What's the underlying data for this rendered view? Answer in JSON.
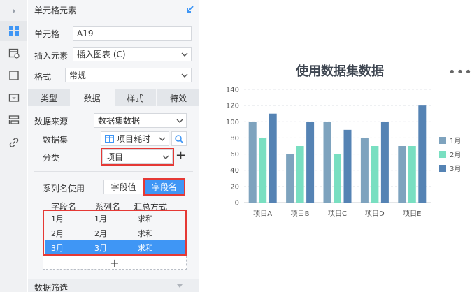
{
  "panel": {
    "title": "单元格元素",
    "cell_label": "单元格",
    "cell_value": "A19",
    "insert_label": "插入元素",
    "insert_value": "插入图表 (C)",
    "format_label": "格式",
    "format_value": "常规",
    "tabs": [
      "类型",
      "数据",
      "样式",
      "特效"
    ],
    "source_label": "数据来源",
    "source_value": "数据集数据",
    "dataset_label": "数据集",
    "dataset_value": "项目耗时",
    "category_label": "分类",
    "category_value": "项目",
    "series_name_label": "系列名使用",
    "seg_field_value": "字段值",
    "seg_field_name": "字段名",
    "table_headers": [
      "字段名",
      "系列名",
      "汇总方式"
    ],
    "rows": [
      {
        "field": "1月",
        "series": "1月",
        "agg": "求和"
      },
      {
        "field": "2月",
        "series": "2月",
        "agg": "求和"
      },
      {
        "field": "3月",
        "series": "3月",
        "agg": "求和"
      }
    ],
    "add_symbol": "+",
    "plus_symbol": "+",
    "filter_label": "数据筛选"
  },
  "chart": {
    "more_symbol": "•••"
  },
  "chart_data": {
    "type": "bar",
    "title": "使用数据集数据",
    "categories": [
      "项目A",
      "项目B",
      "项目C",
      "项目D",
      "项目E"
    ],
    "series": [
      {
        "name": "1月",
        "values": [
          100,
          60,
          100,
          80,
          70
        ],
        "color": "#7ea3be"
      },
      {
        "name": "2月",
        "values": [
          80,
          70,
          60,
          70,
          70
        ],
        "color": "#79dfc1"
      },
      {
        "name": "3月",
        "values": [
          110,
          100,
          90,
          100,
          120
        ],
        "color": "#5583b4"
      }
    ],
    "ylim": [
      0,
      140
    ],
    "yticks": [
      0,
      20,
      40,
      60,
      80,
      100,
      120,
      140
    ],
    "grid": true,
    "legend": "right"
  },
  "colors": {
    "accent": "#3f96f5",
    "highlight": "#e53935"
  }
}
